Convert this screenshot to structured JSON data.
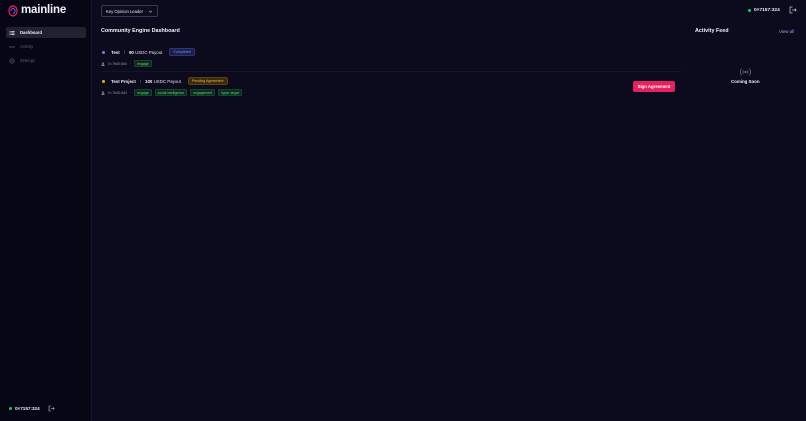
{
  "brand": {
    "name": "mainline"
  },
  "sidebar": {
    "items": [
      {
        "label": "Dashboard",
        "icon": "list-icon",
        "active": true
      },
      {
        "label": "Activity",
        "icon": "activity-icon",
        "active": false
      },
      {
        "label": "Settings",
        "icon": "gear-icon",
        "active": false
      }
    ],
    "wallet": "0×7157:324"
  },
  "header": {
    "role_select": "Key Opinion Leader",
    "wallet": "0×7157:324"
  },
  "main": {
    "title": "Community Engine Dashboard",
    "campaigns": [
      {
        "name": "Test",
        "separator": "/",
        "amount": "90",
        "unit": "USDC Payout",
        "status": "Completed",
        "status_color": "#6b7cf6",
        "user": "0×7b85:884",
        "tags": [
          "engage"
        ]
      },
      {
        "name": "Test Project",
        "separator": "/",
        "amount": "100",
        "unit": "USDC Payout",
        "status": "Pending Agreement",
        "status_color": "#f0a820",
        "user": "0×7b85:884",
        "tags": [
          "engage",
          "social intelligence",
          "engagement",
          "hyper target"
        ],
        "action": "Sign Agreement"
      }
    ]
  },
  "feed": {
    "title": "Activity Feed",
    "view_all": "View all",
    "empty": "Coming Soon"
  },
  "colors": {
    "accent": "#e5225f",
    "background": "#0c0a1d",
    "sidebar": "#070614",
    "online": "#22c55e"
  }
}
